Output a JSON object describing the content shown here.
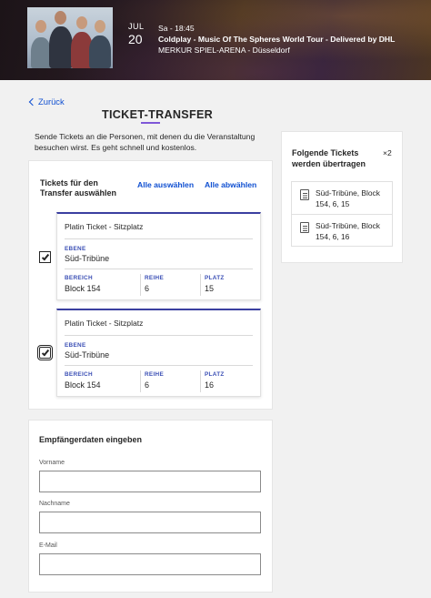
{
  "event": {
    "month": "JUL",
    "day": "20",
    "time": "Sa - 18:45",
    "title": "Coldplay - Music Of The Spheres World Tour - Delivered by DHL",
    "venue": "MERKUR SPIEL-ARENA - Düsseldorf"
  },
  "nav": {
    "back_label": "Zurück"
  },
  "page": {
    "title": "TICKET-TRANSFER",
    "intro": "Sende Tickets an die Personen, mit denen du die Veranstaltung besuchen wirst. Es geht schnell und kostenlos."
  },
  "selection": {
    "heading": "Tickets für den Transfer auswählen",
    "select_all": "Alle auswählen",
    "deselect_all": "Alle abwählen",
    "tickets": [
      {
        "category": "Platin Ticket - Sitzplatz",
        "level_label": "EBENE",
        "level": "Süd-Tribüne",
        "block_label": "BEREICH",
        "block": "Block 154",
        "row_label": "REIHE",
        "row": "6",
        "seat_label": "PLATZ",
        "seat": "15",
        "checked": true
      },
      {
        "category": "Platin Ticket - Sitzplatz",
        "level_label": "EBENE",
        "level": "Süd-Tribüne",
        "block_label": "BEREICH",
        "block": "Block 154",
        "row_label": "REIHE",
        "row": "6",
        "seat_label": "PLATZ",
        "seat": "16",
        "checked": true
      }
    ]
  },
  "summary": {
    "heading": "Folgende Tickets werden übertragen",
    "count": "×2",
    "items": [
      {
        "text": "Süd-Tribüne, Block 154, 6, 15",
        "icon": "ticket-icon"
      },
      {
        "text": "Süd-Tribüne, Block 154, 6, 16",
        "icon": "ticket-icon"
      }
    ]
  },
  "recipient": {
    "heading": "Empfängerdaten eingeben",
    "first_name_label": "Vorname",
    "first_name_value": "",
    "last_name_label": "Nachname",
    "last_name_value": "",
    "email_label": "E-Mail",
    "email_value": ""
  }
}
